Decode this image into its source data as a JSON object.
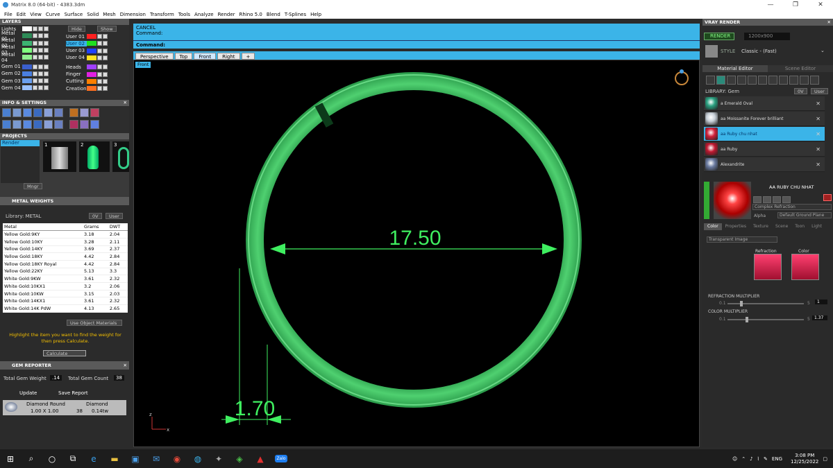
{
  "window": {
    "title": "Matrix 8.0 (64-bit) - 4383.3dm",
    "minimize": "—",
    "maximize": "❐",
    "close": "✕"
  },
  "menu": [
    "File",
    "Edit",
    "View",
    "Curve",
    "Surface",
    "Solid",
    "Mesh",
    "Dimension",
    "Transform",
    "Tools",
    "Analyze",
    "Render",
    "Rhino 5.0",
    "Blend",
    "T-Splines",
    "Help"
  ],
  "layers": {
    "title": "LAYERS",
    "hide": "Hide",
    "show": "Show",
    "left": [
      {
        "name": "Lights",
        "color": "#ffffff"
      },
      {
        "name": "Metal 01",
        "color": "#2e8b57"
      },
      {
        "name": "Metal 02",
        "color": "#3cb371"
      },
      {
        "name": "Metal 03",
        "color": "#7fff7f"
      },
      {
        "name": "Metal 04",
        "color": "#90ee90"
      },
      {
        "name": "Gem 01",
        "color": "#3a5fcd"
      },
      {
        "name": "Gem 02",
        "color": "#4a7fe0"
      },
      {
        "name": "Gem 03",
        "color": "#6a9ff0"
      },
      {
        "name": "Gem 04",
        "color": "#9ac0ff"
      }
    ],
    "right": [
      {
        "name": "User 01",
        "color": "#ff2020"
      },
      {
        "name": "User 02",
        "color": "#20e020",
        "selected": true
      },
      {
        "name": "User 03",
        "color": "#2040ff"
      },
      {
        "name": "User 04",
        "color": "#ffe020"
      },
      {
        "name": "Heads",
        "color": "#a040ff"
      },
      {
        "name": "Finger",
        "color": "#e020e0"
      },
      {
        "name": "Cutting",
        "color": "#ff8000"
      },
      {
        "name": "Creation",
        "color": "#ff7020"
      }
    ]
  },
  "info_settings": {
    "title": "INFO & SETTINGS"
  },
  "projects": {
    "title": "PROJECTS",
    "item": "Render",
    "slots": [
      "1",
      "2",
      "3"
    ],
    "mngr": "Mngr"
  },
  "metal_weights": {
    "title": "METAL WEIGHTS",
    "library": "Library: METAL",
    "lib_btn1": "0V",
    "lib_btn2": "User",
    "columns": [
      "Metal",
      "Grams",
      "DWT"
    ],
    "rows": [
      [
        "Yellow Gold:9KY",
        "3.18",
        "2.04"
      ],
      [
        "Yellow Gold:10KY",
        "3.28",
        "2.11"
      ],
      [
        "Yellow Gold:14KY",
        "3.69",
        "2.37"
      ],
      [
        "Yellow Gold:18KY",
        "4.42",
        "2.84"
      ],
      [
        "Yellow Gold:18KY Royal",
        "4.42",
        "2.84"
      ],
      [
        "Yellow Gold:22KY",
        "5.13",
        "3.3"
      ],
      [
        "White Gold:9KW",
        "3.61",
        "2.32"
      ],
      [
        "White Gold:10KX1",
        "3.2",
        "2.06"
      ],
      [
        "White Gold:10KW",
        "3.15",
        "2.03"
      ],
      [
        "White Gold:14KX1",
        "3.61",
        "2.32"
      ],
      [
        "White Gold:14K PdW",
        "4.13",
        "2.65"
      ]
    ],
    "use_object_materials": "Use Object Materials",
    "hint": "Highlight the item you want to find the weight for then press Calculate.",
    "calculate": "Calculate"
  },
  "gem_reporter": {
    "title": "GEM REPORTER",
    "total_weight_label": "Total Gem Weight",
    "total_weight": ".14",
    "total_count_label": "Total Gem Count",
    "total_count": "38",
    "update": "Update",
    "save_report": "Save Report",
    "row": {
      "shape": "Diamond Round",
      "size": "1.00 X 1.00",
      "type": "Diamond",
      "count": "38",
      "weight": "0.14tw"
    }
  },
  "command": {
    "line1": "CANCEL",
    "line2": "Command:",
    "prompt": "Command:"
  },
  "viewport": {
    "tabs": [
      "Perspective",
      "Top",
      "Front",
      "Right",
      "+"
    ],
    "active_tab": "Front",
    "label": "Front",
    "dimension_diameter": "17.50",
    "dimension_thickness": "1.70",
    "axis_z": "z",
    "axis_x": "x"
  },
  "vray": {
    "title": "VRAY RENDER",
    "render_btn": "RENDER",
    "resolution": "1200x900",
    "style_label": "STYLE",
    "style_value": "Classic - (Fast)",
    "tab_material": "Material Editor",
    "tab_scene": "Scene Editor",
    "library": "LIBRARY: Gem",
    "lib_btn1": "0V",
    "lib_btn2": "User",
    "items": [
      {
        "name": "a Emerald Oval",
        "color": "#2aa080"
      },
      {
        "name": "aa Moissanite Forever brilliant",
        "color": "#c8d0d8"
      },
      {
        "name": "aa Ruby chu nhat",
        "color": "#d0203a",
        "selected": true
      },
      {
        "name": "aa Ruby",
        "color": "#c01830"
      },
      {
        "name": "Alexandrite",
        "color": "#6a7aa0"
      }
    ],
    "material_name": "AA RUBY CHU NHAT",
    "material_type": "Complex Refraction",
    "alpha_label": "Alpha",
    "ground_plane": "Default Ground Plane",
    "prop_tabs": [
      "Color",
      "Properties",
      "Texture",
      "Scene",
      "Toon",
      "Light"
    ],
    "transparent_image": "Transparent Image",
    "swatch1_label": "Refraction",
    "swatch2_label": "Color",
    "refraction_multiplier_label": "REFRACTION MULTIPLIER",
    "refraction_min": "0.1",
    "refraction_max": "5",
    "refraction_value": "1",
    "color_multiplier_label": "COLOR MULTIPLIER",
    "color_min": "0.1",
    "color_max": "5",
    "color_value": "1.37"
  },
  "taskbar": {
    "lang": "ENG",
    "time": "3:08 PM",
    "date": "12/25/2022",
    "zalo": "Zalo"
  }
}
